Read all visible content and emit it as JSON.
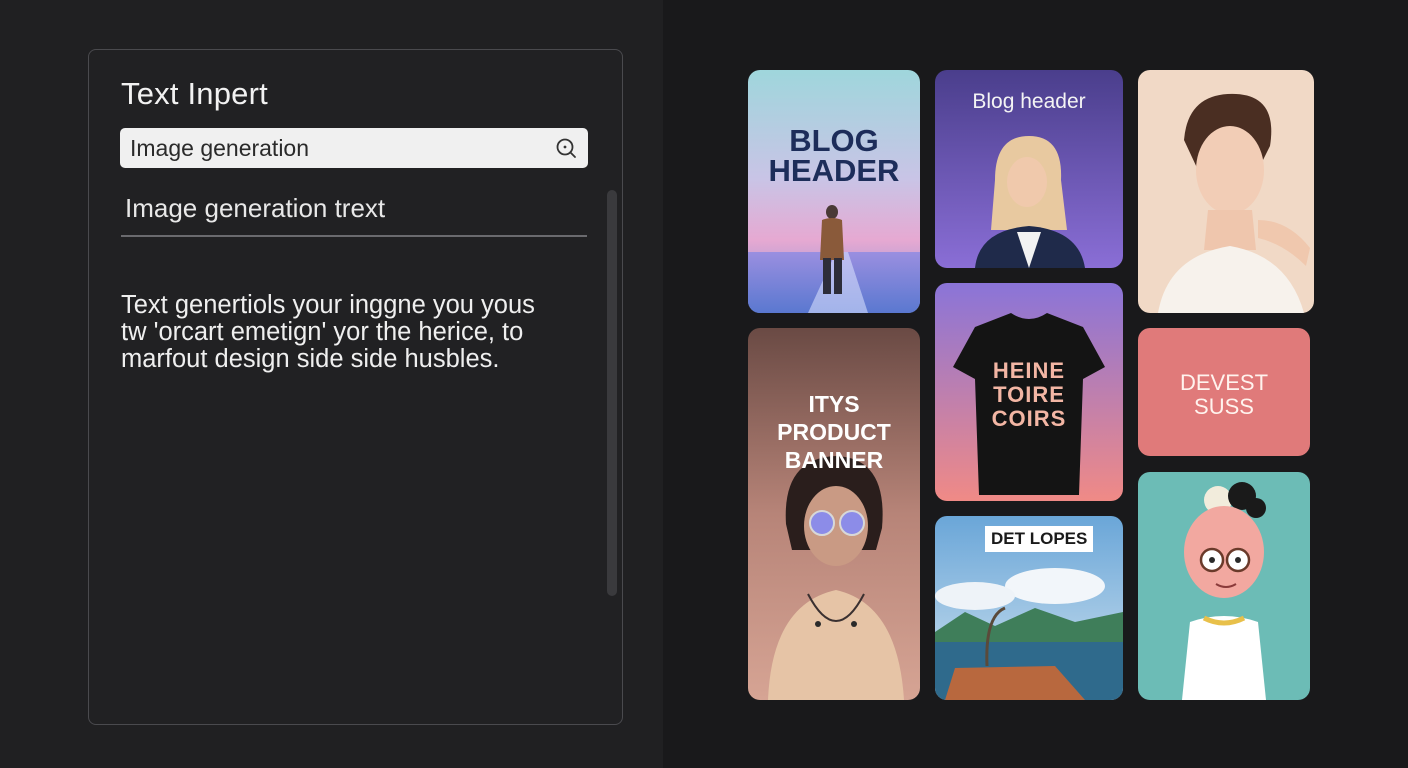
{
  "left_panel": {
    "title": "Text Inpert",
    "search": {
      "value": "Image generation"
    },
    "subtitle": "Image generation trext",
    "description": "Text genertiols your  inggne you yous tw 'orcart emetign' yor the herice, to marfout design side side husbles."
  },
  "gallery": {
    "card1": {
      "headline": "BLOG HEADER"
    },
    "card2": {
      "headline": "Blog header"
    },
    "card3": {
      "headline": ""
    },
    "card4": {
      "headline": "ITYS PRODUCT BANNER"
    },
    "card5": {
      "shirt_text": "HEINE TOIRE COIRS"
    },
    "card6": {
      "headline": "DEVEST SUSS"
    },
    "card7": {
      "headline": "DET LOPES"
    },
    "card8": {
      "headline": ""
    }
  },
  "colors": {
    "accent_pink": "#e07a7a",
    "panel_bg": "#212123",
    "teal": "#6cbcb6"
  },
  "icons": [
    "search-icon"
  ]
}
